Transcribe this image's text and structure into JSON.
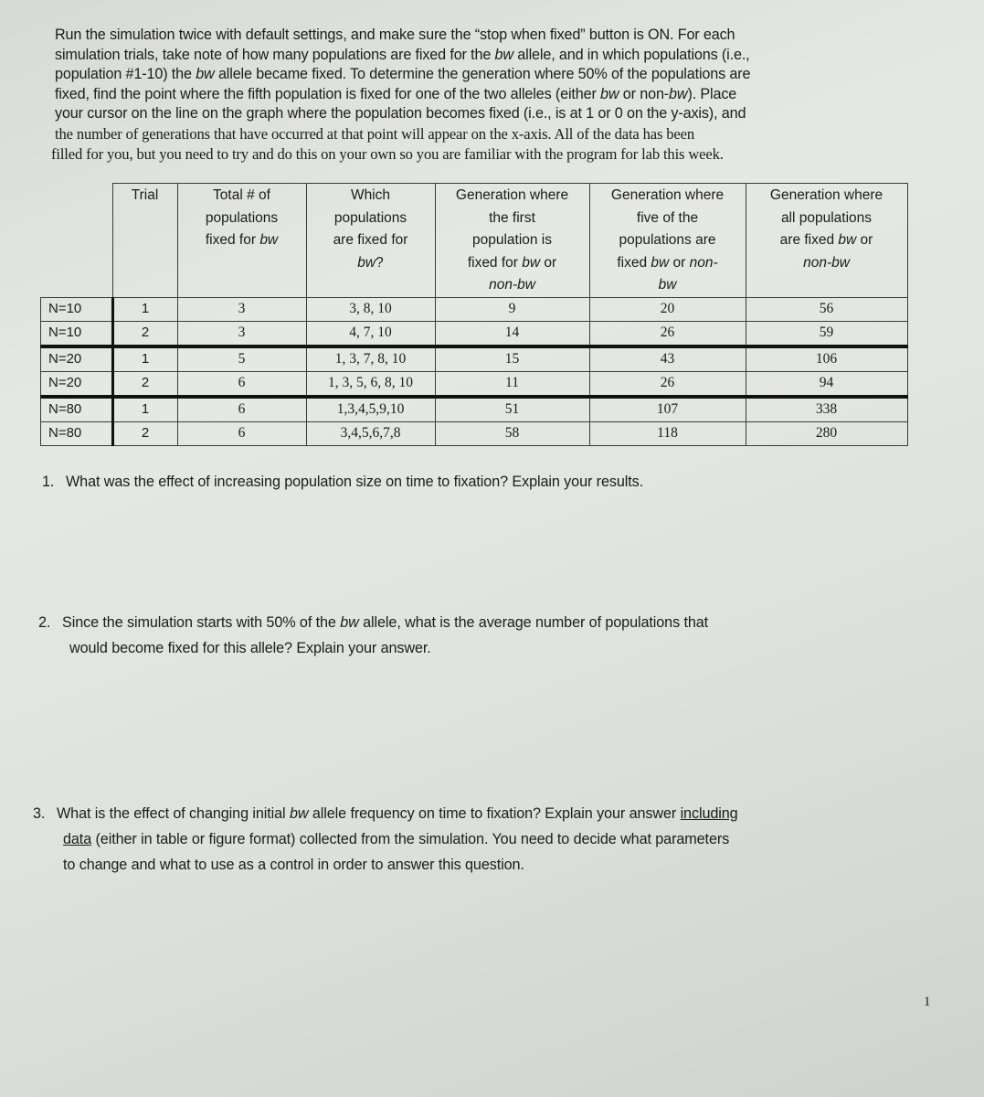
{
  "intro": {
    "lines": [
      "Run the simulation twice with default settings, and make sure the “stop when fixed” button is ON. For each",
      "simulation trials, take note of how many populations are fixed for the ",
      "population #1-10) the ",
      "fixed, find the point where the fifth population is fixed for one of the two alleles (either ",
      "your cursor on the line on the graph where the population becomes fixed (i.e., is at 1 or 0 on the y-axis), and",
      "the number of generations that have occurred at that point will appear on the x-axis.  All of the data has been",
      "filled for you, but you need to try and do this on your own so you are familiar with the program for lab this week."
    ],
    "line2_mid": "bw",
    "line2_end": " allele, and in which populations (i.e.,",
    "line3_mid": "bw",
    "line3_end": " allele became fixed.  To determine the generation where 50% of the populations are",
    "line4_mid1": "bw",
    "line4_mid2": " or non-",
    "line4_mid3": "bw",
    "line4_end": "). Place"
  },
  "table": {
    "headers": {
      "trial": "Trial",
      "total": [
        "Total # of",
        "populations",
        "fixed for "
      ],
      "total_em": "bw",
      "which": [
        "Which",
        "populations",
        "are fixed for"
      ],
      "which_em": "bw",
      "which_end": "?",
      "first": [
        "Generation where",
        "the first",
        "population is",
        "fixed for "
      ],
      "first_em": "bw",
      "first_mid": " or",
      "first_em2": "non-bw",
      "five": [
        "Generation where",
        "five of the",
        "populations are",
        "fixed "
      ],
      "five_em": "bw",
      "five_mid": " or ",
      "five_em2": "non-",
      "five_em3": "bw",
      "all": [
        "Generation where",
        "all populations",
        "are fixed "
      ],
      "all_em": "bw",
      "all_mid": " or",
      "all_em2": "non-bw"
    },
    "rows": [
      {
        "label": "N=10",
        "trial": "1",
        "total": "3",
        "which": "3, 8, 10",
        "first": "9",
        "five": "20",
        "all": "56"
      },
      {
        "label": "N=10",
        "trial": "2",
        "total": "3",
        "which": "4, 7, 10",
        "first": "14",
        "five": "26",
        "all": "59"
      },
      {
        "label": "N=20",
        "trial": "1",
        "total": "5",
        "which": "1, 3, 7, 8, 10",
        "first": "15",
        "five": "43",
        "all": "106"
      },
      {
        "label": "N=20",
        "trial": "2",
        "total": "6",
        "which": "1, 3, 5, 6, 8, 10",
        "first": "11",
        "five": "26",
        "all": "94"
      },
      {
        "label": "N=80",
        "trial": "1",
        "total": "6",
        "which": "1,3,4,5,9,10",
        "first": "51",
        "five": "107",
        "all": "338"
      },
      {
        "label": "N=80",
        "trial": "2",
        "total": "6",
        "which": "3,4,5,6,7,8",
        "first": "58",
        "five": "118",
        "all": "280"
      }
    ]
  },
  "questions": [
    {
      "number": "1.",
      "text": "What was the effect of increasing population size on time to fixation? Explain your results."
    },
    {
      "number": "2.",
      "text_a": "Since the simulation starts with 50% of the ",
      "text_em": "bw",
      "text_b": " allele, what is the average number of populations that",
      "text_c": "would become fixed for this allele? Explain your answer."
    },
    {
      "number": "3.",
      "text_a": "What is the effect of changing initial ",
      "text_em": "bw",
      "text_b": " allele frequency on time to fixation? Explain your answer ",
      "text_u1": "including",
      "text_u2": "data",
      "text_c": " (either in table or figure format) collected from the simulation. You need to decide what parameters",
      "text_d": "to change and what to use as a control in order to answer this question."
    }
  ],
  "page_number": "1"
}
